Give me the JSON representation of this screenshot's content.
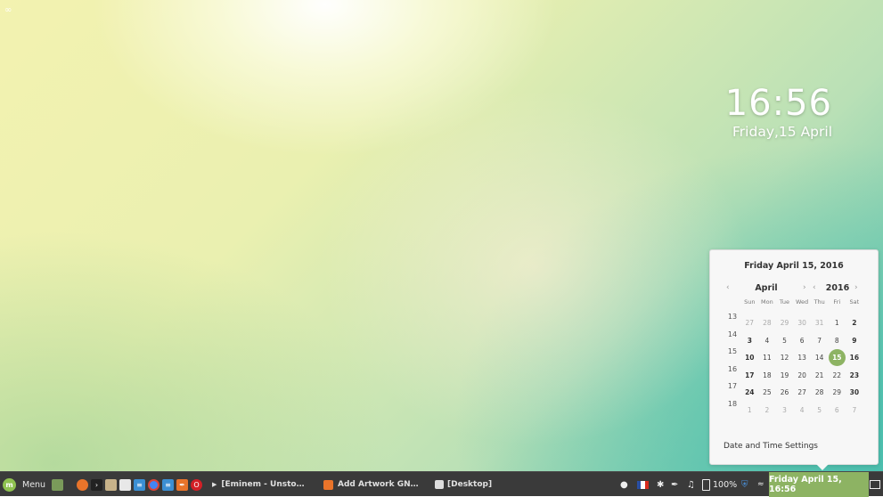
{
  "desktop": {
    "time": "16:56",
    "date": "Friday,15 April"
  },
  "calendar": {
    "title": "Friday April 15, 2016",
    "month": "April",
    "year": "2016",
    "weekdays": [
      "Sun",
      "Mon",
      "Tue",
      "Wed",
      "Thu",
      "Fri",
      "Sat"
    ],
    "week_numbers": [
      "13",
      "14",
      "15",
      "16",
      "17",
      "18"
    ],
    "weeks": [
      [
        "27",
        "28",
        "29",
        "30",
        "31",
        "1",
        "2"
      ],
      [
        "3",
        "4",
        "5",
        "6",
        "7",
        "8",
        "9"
      ],
      [
        "10",
        "11",
        "12",
        "13",
        "14",
        "15",
        "16"
      ],
      [
        "17",
        "18",
        "19",
        "20",
        "21",
        "22",
        "23"
      ],
      [
        "24",
        "25",
        "26",
        "27",
        "28",
        "29",
        "30"
      ],
      [
        "1",
        "2",
        "3",
        "4",
        "5",
        "6",
        "7"
      ]
    ],
    "today": "15",
    "settings_label": "Date and Time Settings"
  },
  "panel": {
    "menu_label": "Menu",
    "tasks": [
      {
        "label": "[Eminem - Unsto…",
        "icon": "play-icon"
      },
      {
        "label": "Add  Artwork GN…",
        "icon": "app-icon"
      },
      {
        "label": "[Desktop]",
        "icon": "window-icon"
      }
    ],
    "battery": "100%",
    "datetime": "Friday April 15, 16:56"
  },
  "colors": {
    "accent": "#8db363",
    "panel_bg": "#3a3a3a",
    "popup_bg": "#f7f7f7"
  }
}
